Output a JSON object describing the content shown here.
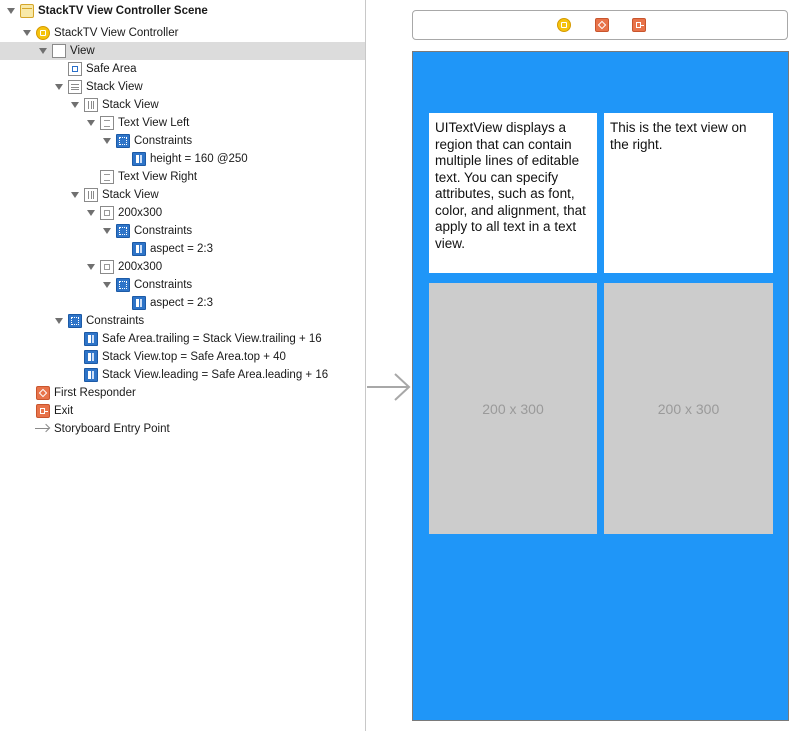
{
  "outline": {
    "scene_title": "StackTV View Controller Scene",
    "view_controller": "StackTV View Controller",
    "view": "View",
    "safe_area": "Safe Area",
    "stack_view_outer": "Stack View",
    "stack_view_top": "Stack View",
    "text_view_left": "Text View Left",
    "constraints_left": "Constraints",
    "height_constraint": "height = 160 @250",
    "text_view_right": "Text View Right",
    "stack_view_bottom": "Stack View",
    "image_one": "200x300",
    "constraints_image_one": "Constraints",
    "aspect_one": "aspect = 2:3",
    "image_two": "200x300",
    "constraints_image_two": "Constraints",
    "aspect_two": "aspect = 2:3",
    "constraints_view": "Constraints",
    "constraint_trailing": "Safe Area.trailing = Stack View.trailing + 16",
    "constraint_top": "Stack View.top = Safe Area.top + 40",
    "constraint_leading": "Stack View.leading = Safe Area.leading + 16",
    "first_responder": "First Responder",
    "exit": "Exit",
    "entry_point": "Storyboard Entry Point"
  },
  "canvas": {
    "text_left": "UITextView displays a region that can contain multiple lines of editable text. You can specify attributes, such as font, color, and alignment, that apply to all text in a text view.",
    "text_right": "This is the text view on the right.",
    "image_left_placeholder": "200 x 300",
    "image_right_placeholder": "200 x 300"
  },
  "colors": {
    "view_background": "#1f96f8",
    "image_placeholder": "#cccccc",
    "selection": "#dcdcdc"
  }
}
